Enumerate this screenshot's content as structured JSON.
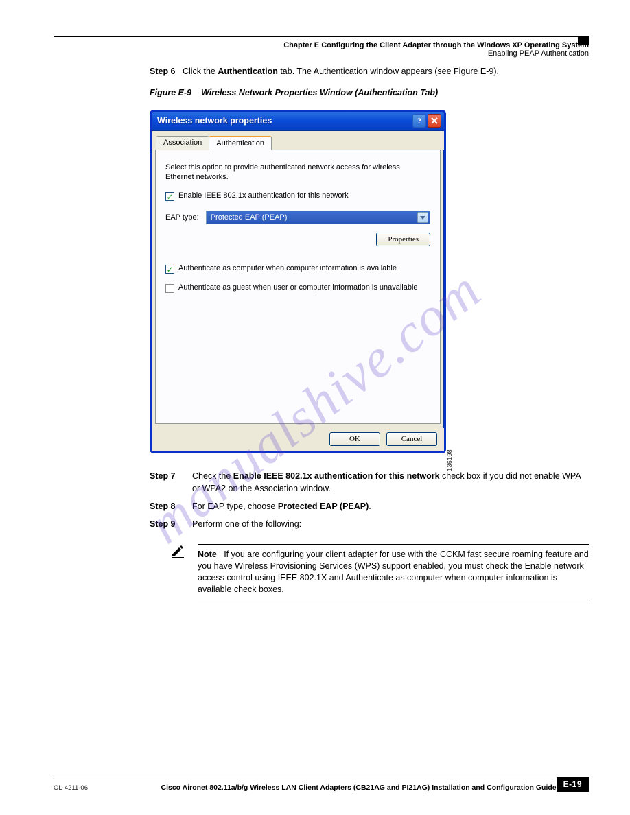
{
  "header": {
    "chapter": "Chapter E      Configuring the Client Adapter through the Windows XP Operating System",
    "breadcrumb": "Enabling PEAP Authentication"
  },
  "step6": {
    "num": "Step 6",
    "text_a": "Click the ",
    "text_b": "Authentication",
    "text_c": " tab. The Authentication window appears (see Figure E-9)."
  },
  "figure": {
    "label": "Figure E-9",
    "title": "Wireless Network Properties Window (Authentication Tab)",
    "image_id": "136198"
  },
  "dialog": {
    "title": "Wireless network properties",
    "tabs": {
      "association": "Association",
      "authentication": "Authentication"
    },
    "intro": "Select this option to provide authenticated network access for wireless Ethernet networks.",
    "enable_8021x": "Enable IEEE 802.1x authentication for this network",
    "eap_label": "EAP type:",
    "eap_value": "Protected EAP (PEAP)",
    "properties": "Properties",
    "auth_computer": "Authenticate as computer when computer information is available",
    "auth_guest": "Authenticate as guest when user or computer information is unavailable",
    "ok": "OK",
    "cancel": "Cancel"
  },
  "step7": {
    "num": "Step 7",
    "a": "Check the ",
    "b": "Enable IEEE 802.1x authentication for this network",
    "c": " check box if you did not enable WPA or WPA2 on the Association window."
  },
  "step8": {
    "num": "Step 8",
    "a": "For EAP type, choose ",
    "b": "Protected EAP (PEAP)",
    "c": "."
  },
  "step9": {
    "num": "Step 9",
    "text": "Perform one of the following:"
  },
  "note": {
    "label": "Note",
    "text": "If you are configuring your client adapter for use with the CCKM fast secure roaming feature and you have Wireless Provisioning Services (WPS) support enabled, you must check the Enable network access control using IEEE 802.1X and Authenticate as computer when computer information is available check boxes."
  },
  "footer": {
    "title": "Cisco Aironet 802.11a/b/g Wireless LAN Client Adapters (CB21AG and PI21AG) Installation and Configuration Guide",
    "docno": "OL-4211-06",
    "page": "E-19"
  }
}
